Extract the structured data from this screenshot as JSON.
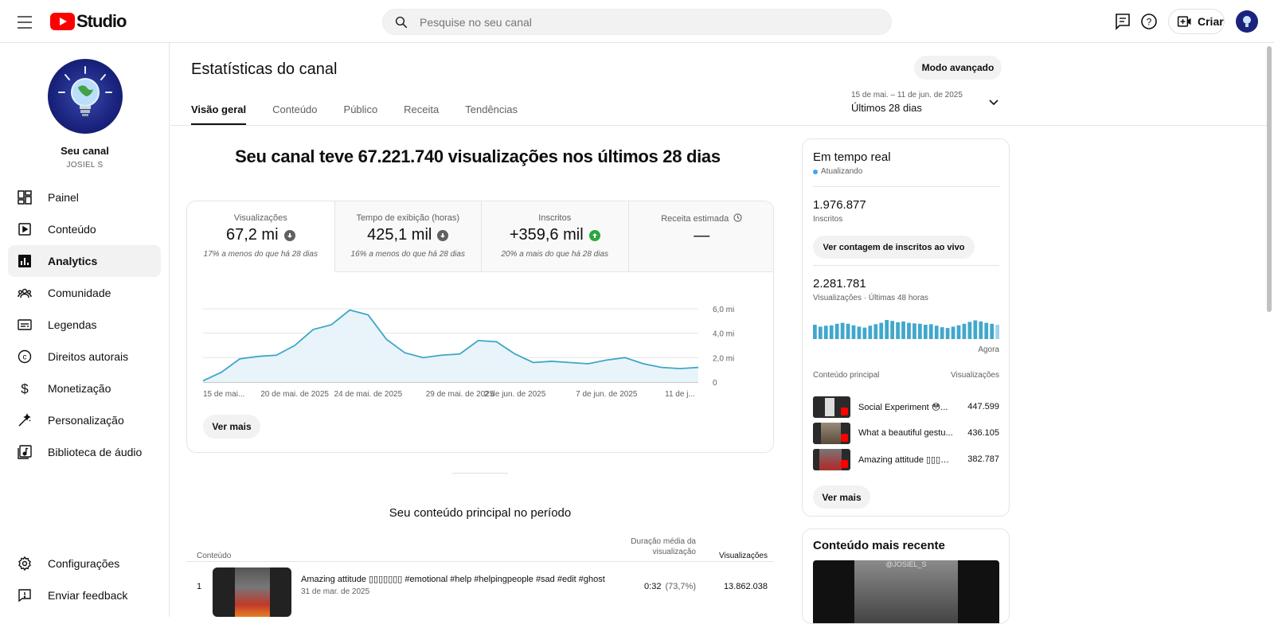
{
  "topbar": {
    "logo_text": "Studio",
    "search_placeholder": "Pesquise no seu canal",
    "create_label": "Criar"
  },
  "sidebar": {
    "channel_name": "Seu canal",
    "channel_handle": "JOSIEL S",
    "items": [
      {
        "label": "Painel",
        "icon": "dashboard-icon"
      },
      {
        "label": "Conteúdo",
        "icon": "content-icon"
      },
      {
        "label": "Analytics",
        "icon": "analytics-icon"
      },
      {
        "label": "Comunidade",
        "icon": "community-icon"
      },
      {
        "label": "Legendas",
        "icon": "subtitles-icon"
      },
      {
        "label": "Direitos autorais",
        "icon": "copyright-icon"
      },
      {
        "label": "Monetização",
        "icon": "monetization-icon"
      },
      {
        "label": "Personalização",
        "icon": "customization-icon"
      },
      {
        "label": "Biblioteca de áudio",
        "icon": "audio-library-icon"
      }
    ],
    "bottom_items": [
      {
        "label": "Configurações",
        "icon": "settings-icon"
      },
      {
        "label": "Enviar feedback",
        "icon": "feedback-icon"
      }
    ]
  },
  "header": {
    "title": "Estatísticas do canal",
    "advanced_mode": "Modo avançado",
    "tabs": [
      "Visão geral",
      "Conteúdo",
      "Público",
      "Receita",
      "Tendências"
    ],
    "date_range": "15 de mai. – 11 de jun. de 2025",
    "date_period": "Últimos 28 dias"
  },
  "overview": {
    "headline": "Seu canal teve 67.221.740 visualizações nos últimos 28 dias",
    "metrics": [
      {
        "label": "Visualizações",
        "value": "67,2 mi",
        "change": "17% a menos do que há 28 dias",
        "trend": "down"
      },
      {
        "label": "Tempo de exibição (horas)",
        "value": "425,1 mil",
        "change": "16% a menos do que há 28 dias",
        "trend": "down"
      },
      {
        "label": "Inscritos",
        "value": "+359,6 mil",
        "change": "20% a mais do que há 28 dias",
        "trend": "up"
      },
      {
        "label": "Receita estimada",
        "value": "—",
        "change": "",
        "trend": "none"
      }
    ],
    "see_more": "Ver mais"
  },
  "chart_data": {
    "type": "area",
    "x": [
      "15 de mai...",
      "",
      "",
      "",
      "",
      "20 de mai. de 2025",
      "",
      "",
      "",
      "24 de mai. de 2025",
      "",
      "",
      "",
      "",
      "29 de mai. de 2025",
      "",
      "",
      "2 de jun. de 2025",
      "",
      "",
      "",
      "",
      "7 de jun. de 2025",
      "",
      "",
      "",
      "11 de j..."
    ],
    "values": [
      0.1,
      0.8,
      1.9,
      2.1,
      2.2,
      3.0,
      4.3,
      4.7,
      5.9,
      5.5,
      3.5,
      2.4,
      2.0,
      2.2,
      2.3,
      3.4,
      3.3,
      2.3,
      1.6,
      1.7,
      1.6,
      1.5,
      1.8,
      2.0,
      1.5,
      1.2,
      1.1,
      1.2
    ],
    "x_tick_labels": [
      "15 de mai...",
      "20 de mai. de 2025",
      "24 de mai. de 2025",
      "29 de mai. de 2025",
      "2 de jun. de 2025",
      "7 de jun. de 2025",
      "11 de j..."
    ],
    "y_tick_labels": [
      "0",
      "2,0 mi",
      "4,0 mi",
      "6,0 mi"
    ],
    "ylim": [
      0,
      6
    ],
    "unit": "mi",
    "color": "#3ea6c8",
    "fill": "#e8f4fa",
    "grid": true
  },
  "top_content": {
    "title": "Seu conteúdo principal no período",
    "col_content": "Conteúdo",
    "col_duration": "Duração média da visualização",
    "col_views": "Visualizações",
    "rows": [
      {
        "rank": "1",
        "title": "Amazing attitude ▯▯▯▯▯▯▯ #emotional #help #helpingpeople #sad #edit #ghost",
        "date": "31 de mar. de 2025",
        "duration": "0:32",
        "percent": "(73,7%)",
        "views": "13.862.038"
      }
    ]
  },
  "realtime": {
    "title": "Em tempo real",
    "status": "Atualizando",
    "subscribers_value": "1.976.877",
    "subscribers_label": "Inscritos",
    "live_count_button": "Ver contagem de inscritos ao vivo",
    "views_value": "2.281.781",
    "views_label": "Visualizações · Últimas 48 horas",
    "now_label": "Agora",
    "col_content": "Conteúdo principal",
    "col_views": "Visualizações",
    "bars": [
      0.75,
      0.65,
      0.7,
      0.72,
      0.8,
      0.85,
      0.8,
      0.72,
      0.65,
      0.6,
      0.7,
      0.78,
      0.85,
      1.0,
      0.95,
      0.88,
      0.92,
      0.85,
      0.82,
      0.8,
      0.75,
      0.78,
      0.7,
      0.62,
      0.58,
      0.65,
      0.72,
      0.8,
      0.9,
      0.98,
      0.92,
      0.85,
      0.8,
      0.75
    ],
    "items": [
      {
        "title": "Social Experiment 😳...",
        "views": "447.599"
      },
      {
        "title": "What a beautiful gestu...",
        "views": "436.105"
      },
      {
        "title": "Amazing attitude ▯▯▯▯▯...",
        "views": "382.787"
      }
    ],
    "see_more": "Ver mais"
  },
  "recent": {
    "title": "Conteúdo mais recente",
    "watermark": "@JOSIEL_S"
  }
}
